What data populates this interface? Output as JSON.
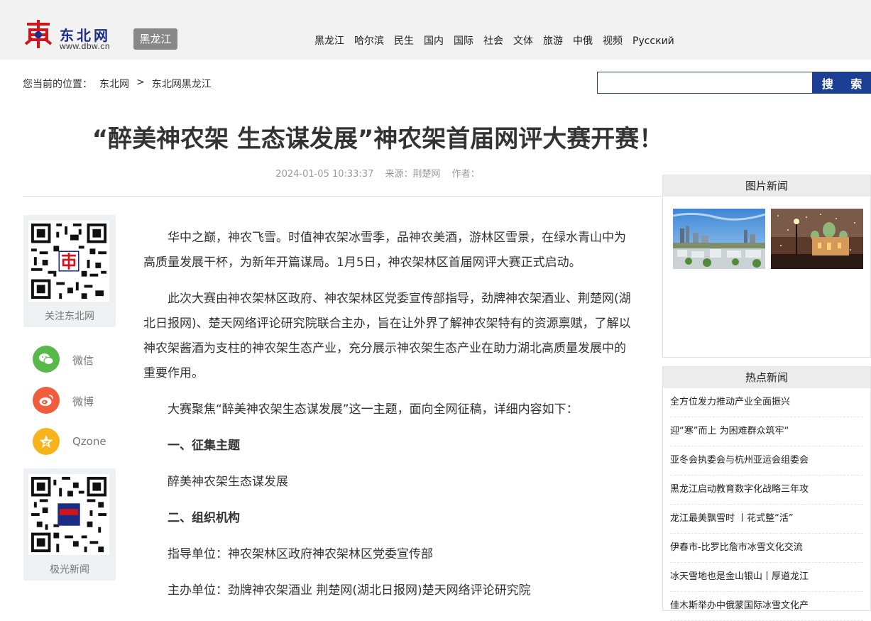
{
  "header": {
    "logo_text": "东北网",
    "logo_url": "www.dbw.cn",
    "badge": "黑龙江",
    "nav": [
      "黑龙江",
      "哈尔滨",
      "民生",
      "国内",
      "国际",
      "社会",
      "文体",
      "旅游",
      "中俄",
      "视频",
      "Русский"
    ]
  },
  "breadcrumb": {
    "prefix": "您当前的位置：",
    "items": [
      "东北网",
      "东北网黑龙江"
    ],
    "separator": ">"
  },
  "search": {
    "value": "",
    "button_label": "搜 索"
  },
  "article": {
    "title": "“醉美神农架 生态谋发展”神农架首届网评大赛开赛！",
    "date": "2024-01-05 10:33:37",
    "source": "来源：荆楚网",
    "author": "作者：",
    "paragraphs": [
      "华中之巅，神农飞雪。时值神农架冰雪季，品神农美酒，游林区雪景，在绿水青山中为高质量发展干杯，为新年开篇谋局。1月5日，神农架林区首届网评大赛正式启动。",
      "此次大赛由神农架林区政府、神农架林区党委宣传部指导，劲牌神农架酒业、荆楚网(湖北日报网)、楚天网络评论研究院联合主办，旨在让外界了解神农架特有的资源禀赋，了解以神农架酱酒为支柱的神农架生态产业，充分展示神农架生态产业在助力湖北高质量发展中的重要作用。",
      "大赛聚焦“醉美神农架生态谋发展”这一主题，面向全网征稿，详细内容如下："
    ],
    "section1_title": "一、征集主题",
    "section1_text": "醉美神农架生态谋发展",
    "section2_title": "二、组织机构",
    "guide_unit": "指导单位：神农架林区政府神农架林区党委宣传部",
    "host_unit": "主办单位：劲牌神农架酒业 荆楚网(湖北日报网)楚天网络评论研究院"
  },
  "share": {
    "qr1_label": "关注东北网",
    "qr1_center": "东北网",
    "wechat": "微信",
    "weibo": "微博",
    "qzone": "Qzone",
    "qr2_label": "极光新闻",
    "qr2_center": "东北网"
  },
  "sidebar": {
    "pic_news_title": "图片新闻",
    "hot_news_title": "热点新闻",
    "hot_news": [
      "全方位发力推动产业全面振兴",
      "迎“寒”而上 为困难群众筑牢“",
      "亚冬会执委会与杭州亚运会组委会",
      "黑龙江启动教育数字化战略三年攻",
      "龙江最美飘雪时 丨花式整“活”",
      "伊春市-比罗比詹市冰雪文化交流",
      "冰天雪地也是金山银山丨厚道龙江",
      "佳木斯举办中俄蒙国际冰雪文化产"
    ]
  },
  "colors": {
    "brand_blue": "#1c3f94",
    "logo_red": "#d0151c",
    "wechat": "#57b94a",
    "weibo": "#f05c3c",
    "qzone": "#f6b31c"
  }
}
